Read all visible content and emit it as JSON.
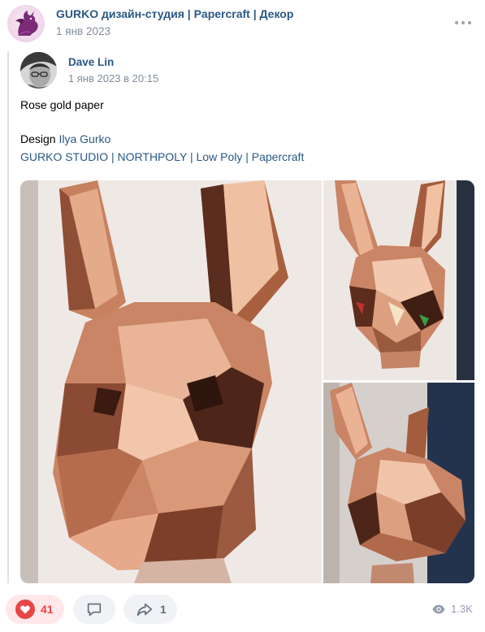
{
  "group": {
    "name": "GURKO дизайн-студия | Papercraft | Декор",
    "date": "1 янв 2023",
    "avatar_icon": "dragon-logo-icon"
  },
  "repost": {
    "author_name": "Dave Lin",
    "author_date": "1 янв 2023 в 20:15",
    "text_line1": "Rose gold paper",
    "design_prefix": "Design ",
    "design_link": "Ilya Gurko",
    "tags_line": "GURKO STUDIO | NORTHPOLY | Low Poly | Papercraft"
  },
  "actions": {
    "likes": "41",
    "comments_icon": "comment-icon",
    "shares": "1",
    "views": "1.3K"
  },
  "colors": {
    "link": "#2a5885",
    "meta": "#818c99",
    "like": "#e64646",
    "like_bg": "#ffe7ea",
    "button_bg": "#f0f2f5"
  }
}
